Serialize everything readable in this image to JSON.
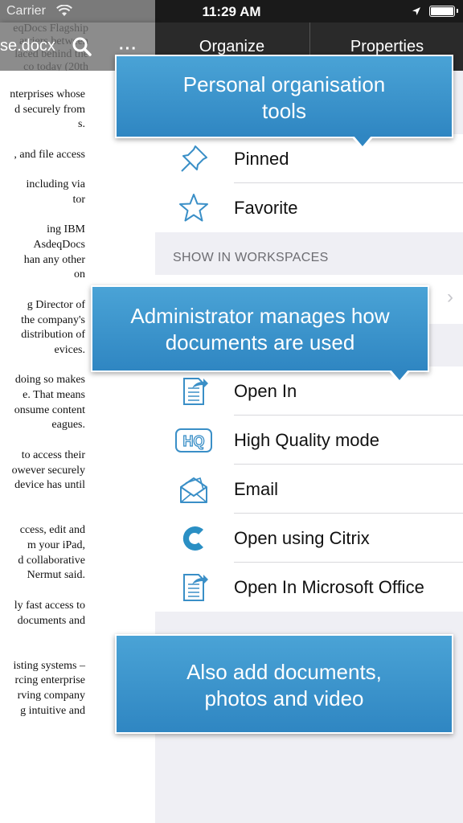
{
  "status_bar": {
    "carrier": "Carrier",
    "time": "11:29 AM"
  },
  "document": {
    "title": "se.docx",
    "header_lines": [
      "eqDocs Flagship",
      "arriers between",
      "laced behind the",
      "co today (20th"
    ],
    "lines": [
      "nterprises whose",
      "d securely from",
      "s.",
      "",
      ", and file access",
      "",
      "including via",
      "tor",
      "",
      "ing IBM",
      "AsdeqDocs",
      "han any other",
      "on",
      "",
      "g Director of",
      "the company's",
      "distribution of",
      "evices.",
      "",
      "doing so makes",
      "e. That means",
      "onsume content",
      "eagues.",
      "",
      "to access their",
      "owever securely",
      "device has until",
      "",
      "",
      "ccess, edit and",
      "m your iPad,",
      "d collaborative",
      "Nermut said.",
      "",
      "ly fast access to",
      "documents and",
      "",
      "",
      "isting systems –",
      "rcing enterprise",
      "rving company",
      "g intuitive and"
    ]
  },
  "panel": {
    "tabs": [
      "Organize",
      "Properties"
    ],
    "organize_items": [
      {
        "label": "Pinned",
        "icon": "pin-icon"
      },
      {
        "label": "Favorite",
        "icon": "star-icon"
      }
    ],
    "workspaces_header": "SHOW IN WORKSPACES",
    "actions": [
      {
        "label": "Open In",
        "icon": "open-in-icon"
      },
      {
        "label": "High Quality mode",
        "icon": "hq-icon"
      },
      {
        "label": "Email",
        "icon": "email-icon"
      },
      {
        "label": "Open using Citrix",
        "icon": "citrix-icon"
      },
      {
        "label": "Open In Microsoft Office",
        "icon": "open-in-office-icon"
      }
    ]
  },
  "callouts": {
    "top": "Personal organisation tools",
    "middle": "Administrator manages how documents are used",
    "bottom": "Also add documents, photos and video"
  },
  "colors": {
    "accent": "#2f86c2",
    "icon_blue": "#3a8fc7"
  }
}
